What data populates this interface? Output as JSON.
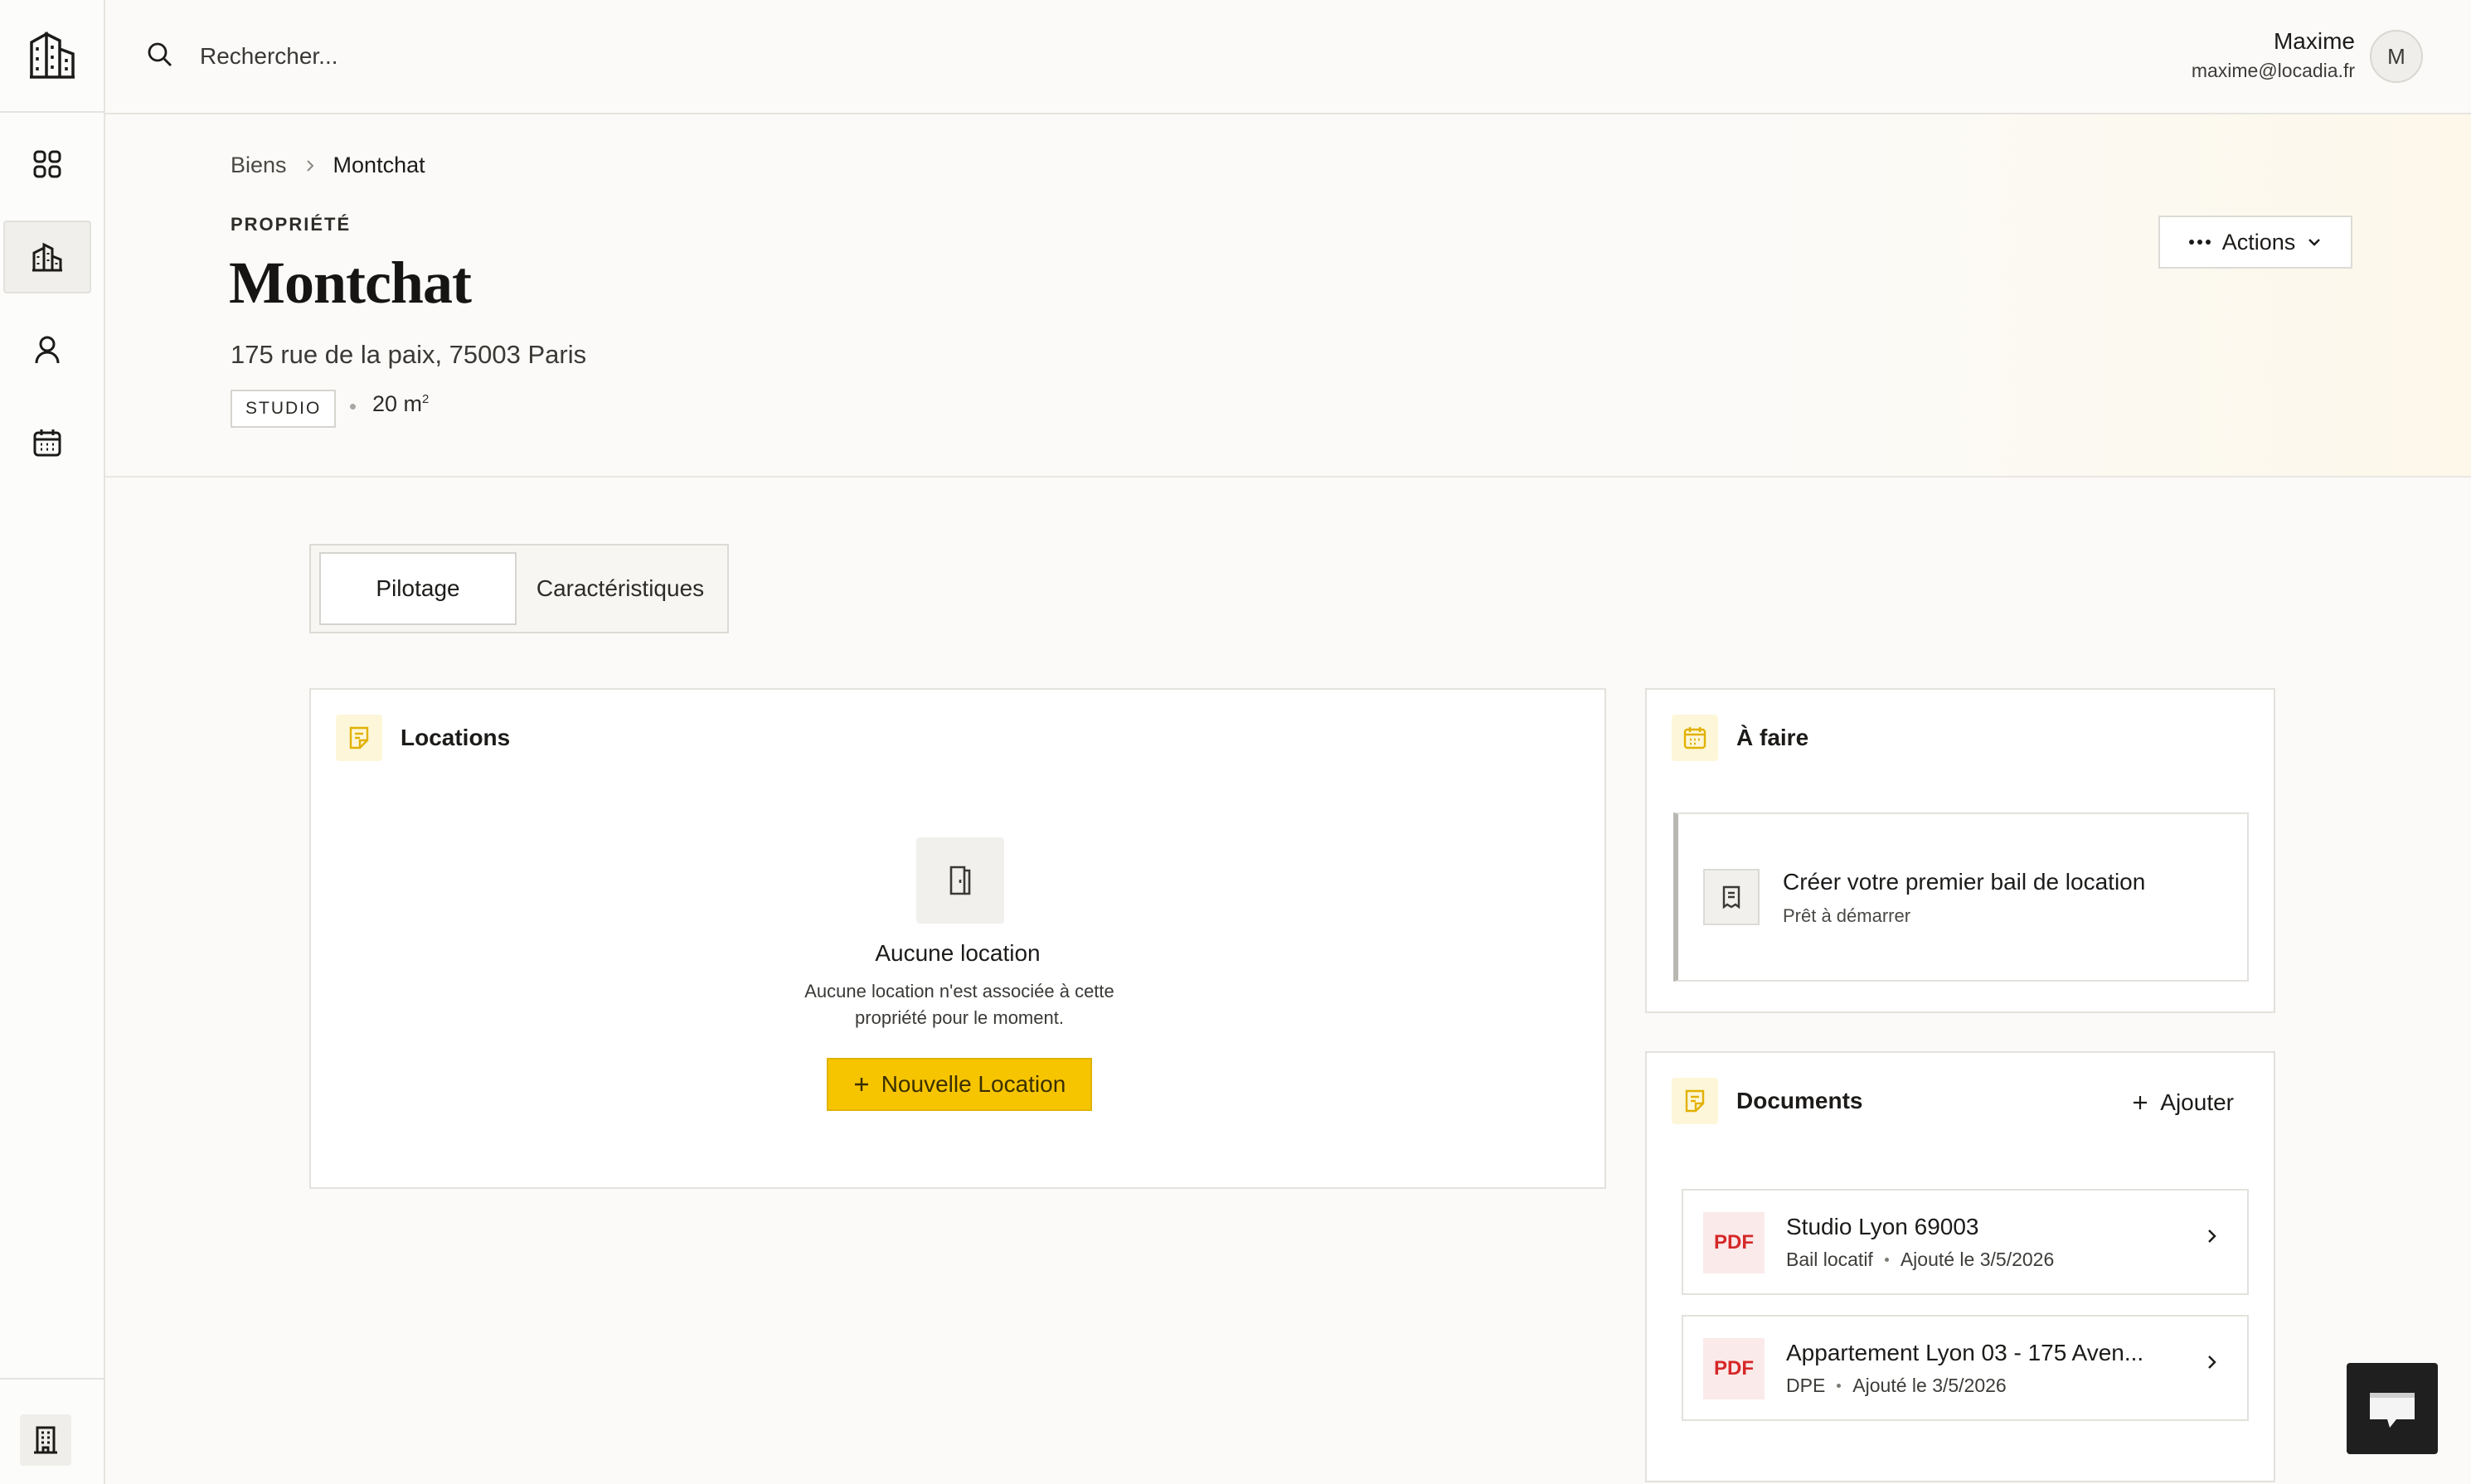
{
  "topbar": {
    "search_placeholder": "Rechercher...",
    "user_name": "Maxime",
    "user_email": "maxime@locadia.fr",
    "avatar_initial": "M"
  },
  "sidebar": {
    "items": [
      {
        "icon": "dashboard-grid-icon",
        "active": false
      },
      {
        "icon": "buildings-icon",
        "active": true
      },
      {
        "icon": "person-icon",
        "active": false
      },
      {
        "icon": "calendar-icon",
        "active": false
      }
    ],
    "bottom_icon": "office-building-icon"
  },
  "breadcrumb": {
    "parent": "Biens",
    "current": "Montchat"
  },
  "header": {
    "eyebrow": "PROPRIÉTÉ",
    "title": "Montchat",
    "address": "175 rue de la paix, 75003 Paris",
    "type_tag": "STUDIO",
    "area": "20 m",
    "area_sup": "2",
    "actions_label": "Actions"
  },
  "tabs": [
    {
      "label": "Pilotage",
      "active": true
    },
    {
      "label": "Caractéristiques",
      "active": false
    }
  ],
  "locations": {
    "title": "Locations",
    "empty_title": "Aucune location",
    "empty_desc": "Aucune location n'est associée à cette propriété pour le moment.",
    "new_button": "Nouvelle Location"
  },
  "todo": {
    "title": "À faire",
    "item_title": "Créer votre premier bail de location",
    "item_sub": "Prêt à démarrer"
  },
  "documents": {
    "title": "Documents",
    "add_label": "Ajouter",
    "items": [
      {
        "badge": "PDF",
        "name": "Studio Lyon 69003",
        "type": "Bail locatif",
        "date": "Ajouté le 3/5/2026"
      },
      {
        "badge": "PDF",
        "name": "Appartement Lyon 03 - 175 Aven...",
        "type": "DPE",
        "date": "Ajouté le 3/5/2026"
      }
    ]
  },
  "colors": {
    "accent": "#f7c500",
    "pdf_red": "#d62828",
    "icon_bg_yellow": "#fdf6d9"
  }
}
